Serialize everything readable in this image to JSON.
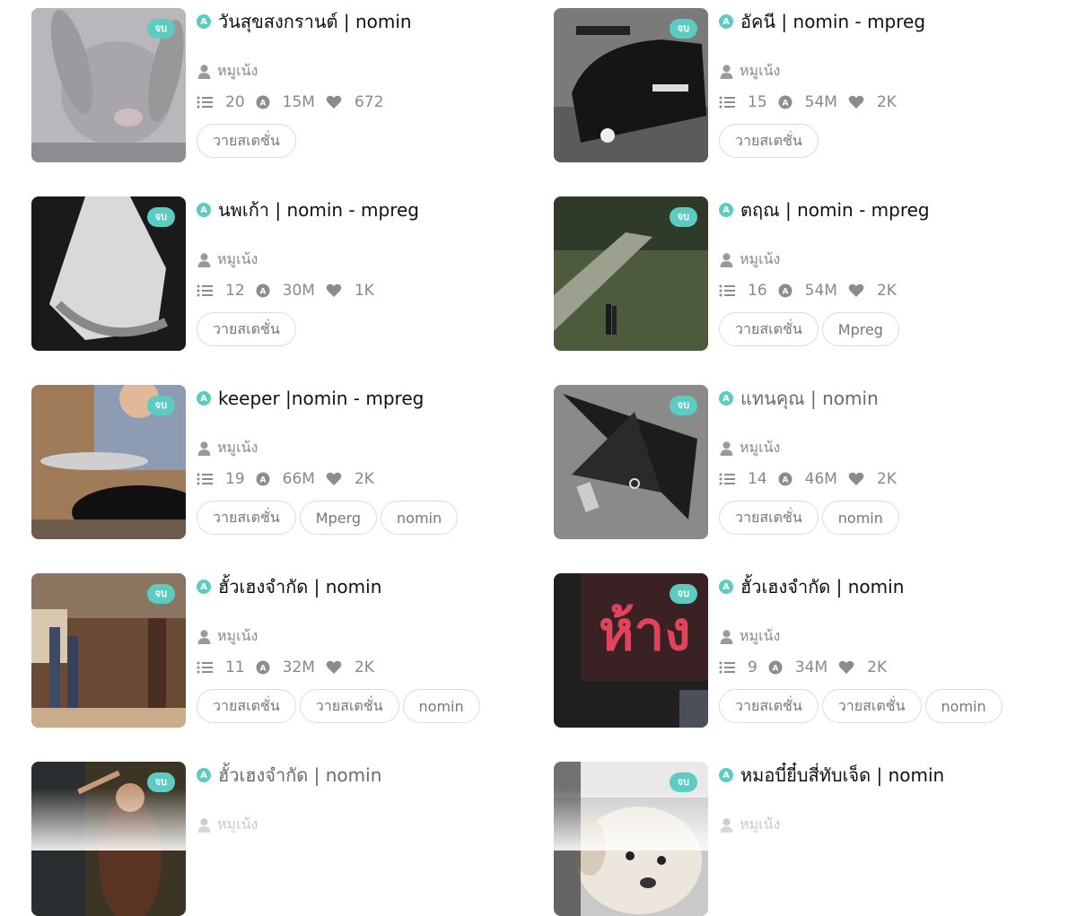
{
  "badge_label": "จบ",
  "stories": [
    {
      "title": "วันสุขสงกรานต์ | nomin",
      "author": "หมูเน้ง",
      "chapters": "20",
      "views": "15M",
      "likes": "672",
      "tags": [
        "วายสเตชั่น"
      ],
      "muted": false
    },
    {
      "title": "อัคนี | nomin - mpreg",
      "author": "หมูเน้ง",
      "chapters": "15",
      "views": "54M",
      "likes": "2K",
      "tags": [
        "วายสเตชั่น"
      ],
      "muted": false
    },
    {
      "title": "นพเก้า | nomin - mpreg",
      "author": "หมูเน้ง",
      "chapters": "12",
      "views": "30M",
      "likes": "1K",
      "tags": [
        "วายสเตชั่น"
      ],
      "muted": false
    },
    {
      "title": "ตฤณ | nomin - mpreg",
      "author": "หมูเน้ง",
      "chapters": "16",
      "views": "54M",
      "likes": "2K",
      "tags": [
        "วายสเตชั่น",
        "Mpreg"
      ],
      "muted": false
    },
    {
      "title": "keeper |nomin - mpreg",
      "author": "หมูเน้ง",
      "chapters": "19",
      "views": "66M",
      "likes": "2K",
      "tags": [
        "วายสเตชั่น",
        "Mperg",
        "nomin"
      ],
      "muted": false
    },
    {
      "title": "แทนคุณ | nomin",
      "author": "หมูเน้ง",
      "chapters": "14",
      "views": "46M",
      "likes": "2K",
      "tags": [
        "วายสเตชั่น",
        "nomin"
      ],
      "muted": true
    },
    {
      "title": "ฮั้วเฮงจำกัด | nomin",
      "author": "หมูเน้ง",
      "chapters": "11",
      "views": "32M",
      "likes": "2K",
      "tags": [
        "วายสเตชั่น",
        "วายสเตชั่น",
        "nomin"
      ],
      "muted": false
    },
    {
      "title": "ฮั้วเฮงจำกัด | nomin",
      "author": "หมูเน้ง",
      "chapters": "9",
      "views": "34M",
      "likes": "2K",
      "tags": [
        "วายสเตชั่น",
        "วายสเตชั่น",
        "nomin"
      ],
      "muted": false
    },
    {
      "title": "ฮั้วเฮงจำกัด | nomin",
      "author": "หมูเน้ง",
      "chapters": "",
      "views": "",
      "likes": "",
      "tags": [],
      "muted": true
    },
    {
      "title": "หมอบี๋ยี๋บสี่ทับเจ็ด | nomin",
      "author": "หมูเน้ง",
      "chapters": "",
      "views": "",
      "likes": "",
      "tags": [],
      "muted": false
    }
  ],
  "colors": {
    "accent": "#5ccbc1",
    "muted_text": "#888888",
    "tag_border": "#dcdcdc"
  },
  "thumb_images": [
    "plush-rabbit-photo",
    "race-car-photo",
    "white-dress-photo",
    "couple-on-hill-photo",
    "child-with-pan-photo",
    "high-heels-photo",
    "dancing-feet-photo",
    "neon-sign-photo",
    "dancer-photo",
    "puppy-photo"
  ]
}
